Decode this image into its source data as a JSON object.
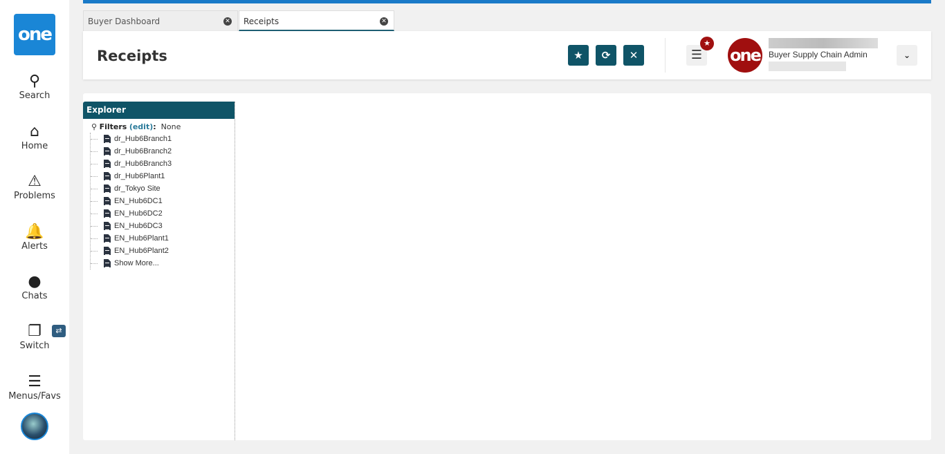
{
  "sidebar": {
    "logo": "one",
    "items": [
      {
        "label": "Search",
        "icon": "search-icon"
      },
      {
        "label": "Home",
        "icon": "home-icon"
      },
      {
        "label": "Problems",
        "icon": "warning-icon"
      },
      {
        "label": "Alerts",
        "icon": "bell-icon"
      },
      {
        "label": "Chats",
        "icon": "chat-icon"
      },
      {
        "label": "Switch",
        "icon": "switch-icon"
      },
      {
        "label": "Menus/Favs",
        "icon": "menu-icon"
      }
    ]
  },
  "tabs": [
    {
      "label": "Buyer Dashboard"
    },
    {
      "label": "Receipts",
      "active": true
    }
  ],
  "header": {
    "title": "Receipts",
    "user_role": "Buyer Supply Chain Admin",
    "avatar_text": "one"
  },
  "explorer": {
    "title": "Explorer",
    "filters_label": "Filters",
    "edit_label": "(edit)",
    "filters_value": "None",
    "items": [
      "dr_Hub6Branch1",
      "dr_Hub6Branch2",
      "dr_Hub6Branch3",
      "dr_Hub6Plant1",
      "dr_Tokyo Site",
      "EN_Hub6DC1",
      "EN_Hub6DC2",
      "EN_Hub6DC3",
      "EN_Hub6Plant1",
      "EN_Hub6Plant2",
      "Show More..."
    ]
  },
  "colors": {
    "accent": "#0f5467",
    "brand": "#1a86d6",
    "avatar": "#a00f0f"
  }
}
